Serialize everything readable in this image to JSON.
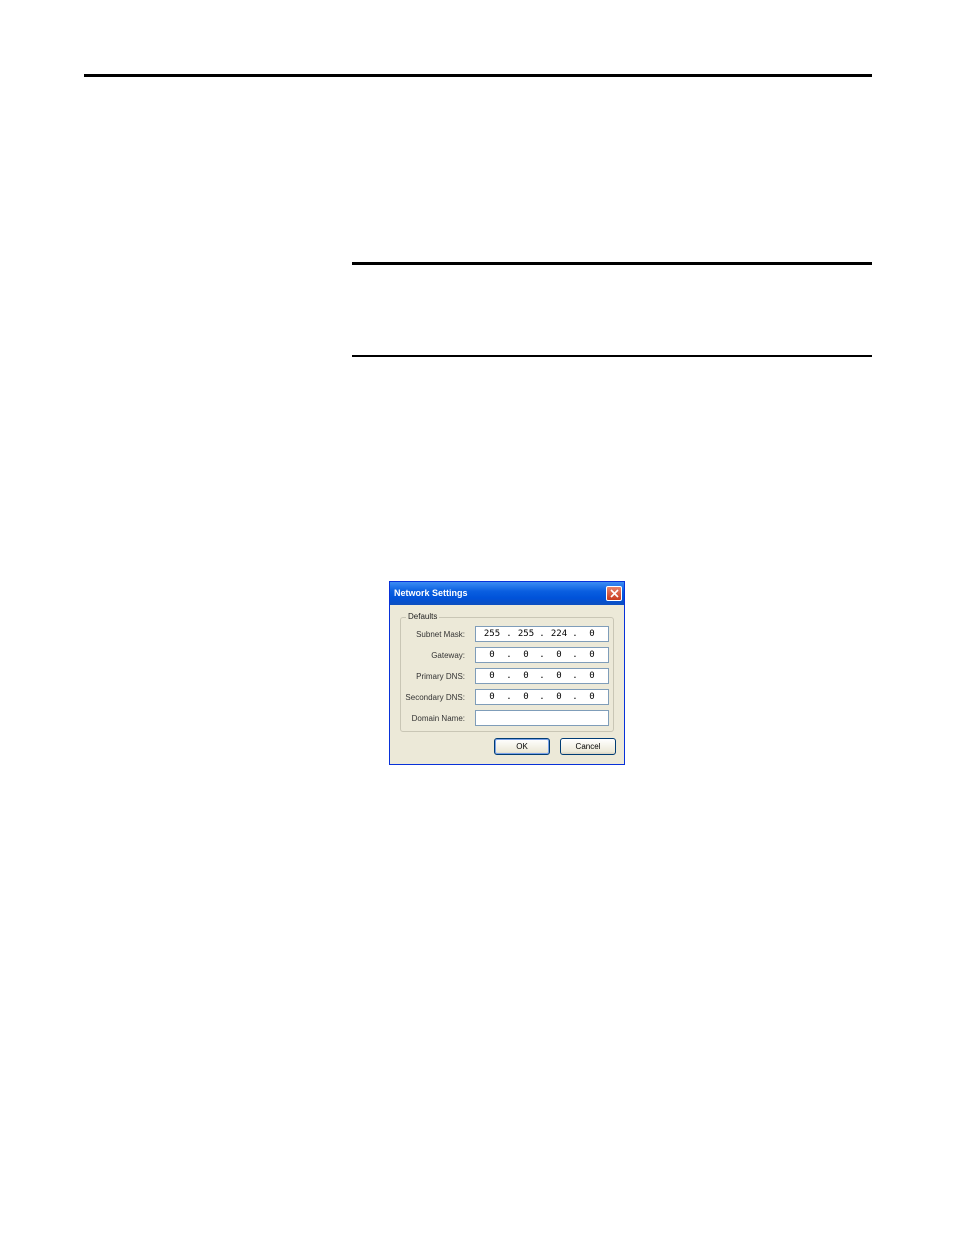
{
  "dialog": {
    "title": "Network Settings",
    "group_label": "Defaults",
    "fields": [
      {
        "label": "Subnet Mask:",
        "octets": [
          "255",
          "255",
          "224",
          "0"
        ]
      },
      {
        "label": "Gateway:",
        "octets": [
          "0",
          "0",
          "0",
          "0"
        ]
      },
      {
        "label": "Primary DNS:",
        "octets": [
          "0",
          "0",
          "0",
          "0"
        ]
      },
      {
        "label": "Secondary DNS:",
        "octets": [
          "0",
          "0",
          "0",
          "0"
        ]
      }
    ],
    "domain_label": "Domain Name:",
    "domain_value": "",
    "ok_label": "OK",
    "cancel_label": "Cancel",
    "close_icon": "close-icon",
    "colors": {
      "titlebar": "#0a5fe0",
      "close": "#c73b1f",
      "face": "#ece9d8"
    }
  }
}
